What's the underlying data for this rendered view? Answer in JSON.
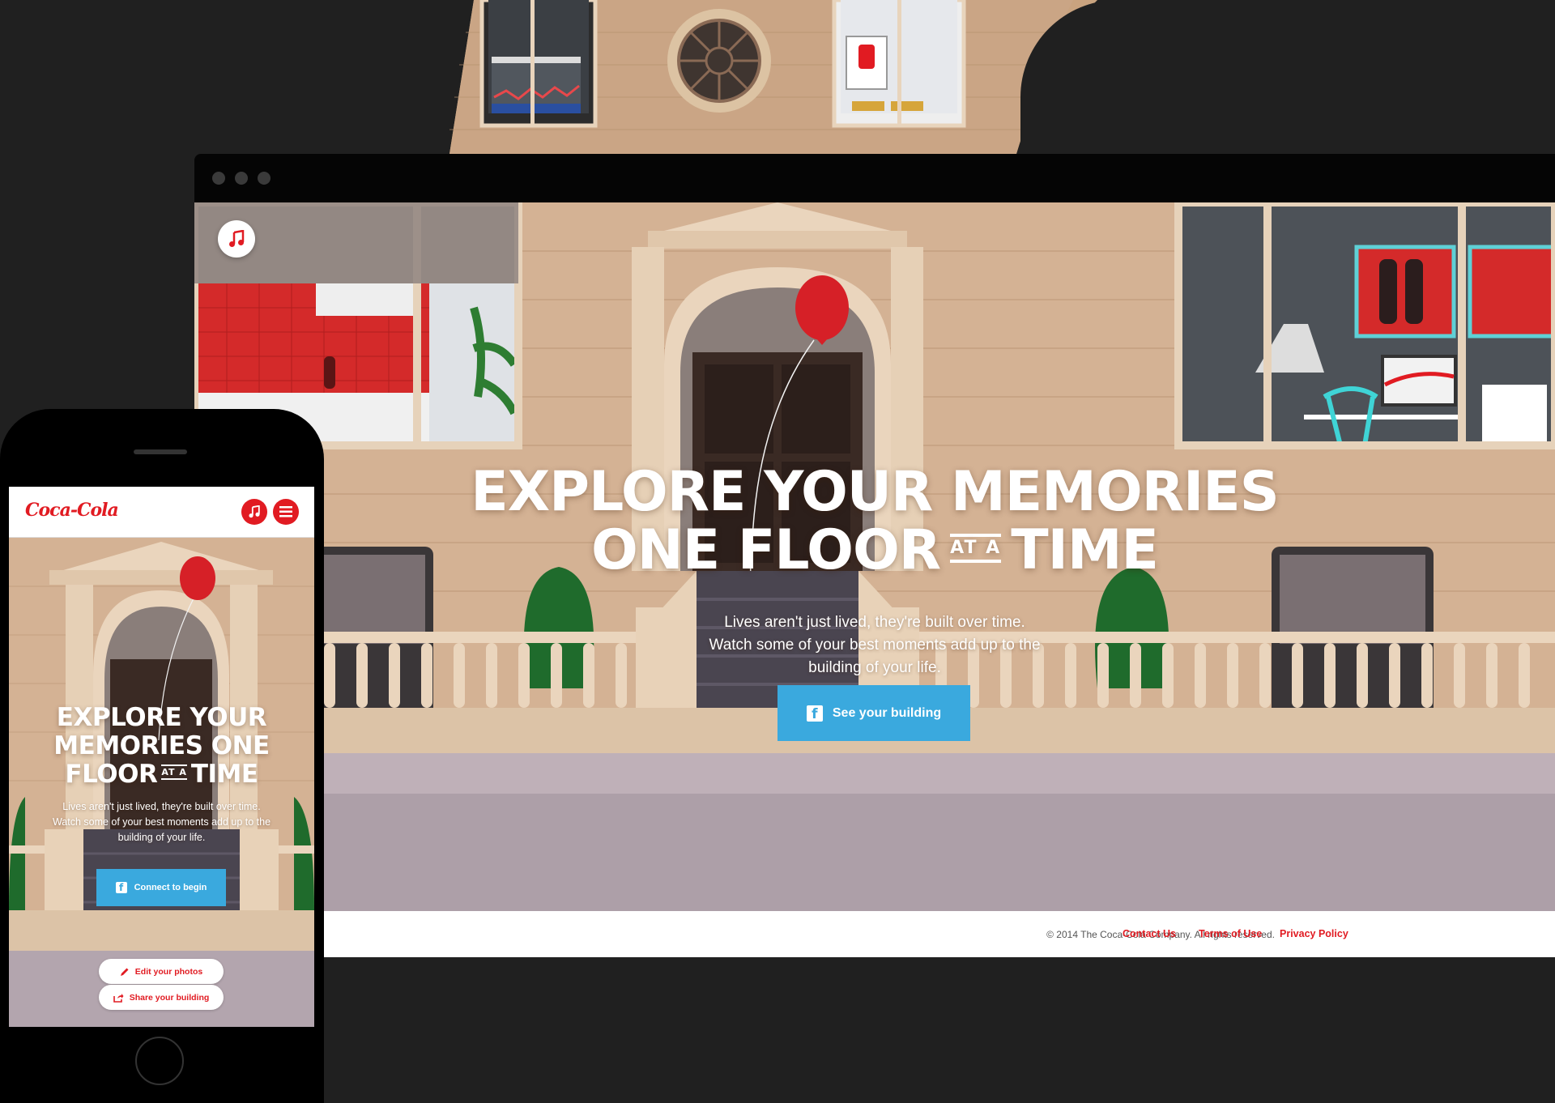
{
  "colors": {
    "background": "#202020",
    "brand_red": "#e11b22",
    "cta_blue": "#3aa9de",
    "stone": "#d6b495"
  },
  "desktop": {
    "window_controls": [
      "dot",
      "dot",
      "dot"
    ],
    "music_icon": "music-note-icon",
    "hero": {
      "title_line1": "EXPLORE YOUR MEMORIES",
      "title_line2_a": "ONE FLOOR",
      "title_line2_ata": "AT A",
      "title_line2_b": "TIME",
      "subtitle_line1": "Lives aren't just lived, they're built over time.",
      "subtitle_line2": "Watch some of your best moments add up to the",
      "subtitle_line3": "building of your life."
    },
    "cta": {
      "icon": "facebook-icon",
      "label": "See your building"
    },
    "footer": {
      "copyright": "© 2014 The Coca-Cola Company. All rights reserved.",
      "links": [
        "Contact Us",
        "Terms of Use",
        "Privacy Policy"
      ]
    }
  },
  "phone": {
    "logo": "Coca-Cola",
    "header_icons": [
      "music-note-icon",
      "menu-icon"
    ],
    "hero": {
      "title_line1": "EXPLORE YOUR",
      "title_line2": "MEMORIES ONE",
      "title_line3_a": "FLOOR",
      "title_line3_ata": "AT A",
      "title_line3_b": "TIME",
      "subtitle_line1": "Lives aren't just lived, they're built over time.",
      "subtitle_line2": "Watch some of your best moments add up to the",
      "subtitle_line3": "building of your life."
    },
    "cta": {
      "icon": "facebook-icon",
      "label": "Connect to begin"
    },
    "actions": [
      {
        "icon": "pencil-icon",
        "label": "Edit your photos"
      },
      {
        "icon": "share-icon",
        "label": "Share your building"
      }
    ]
  }
}
